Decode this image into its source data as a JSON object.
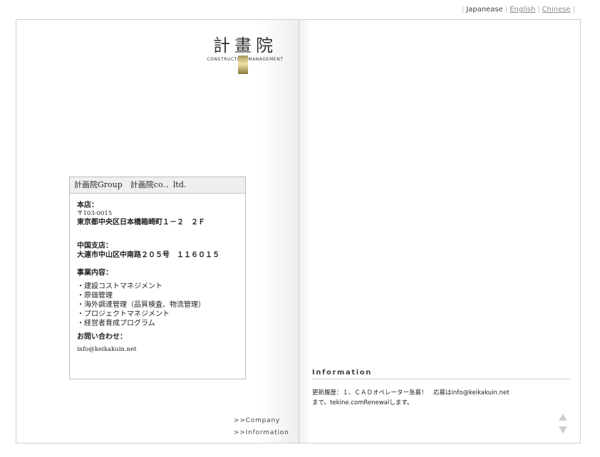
{
  "language_bar": {
    "current": "Japanease",
    "english": "English",
    "chinese": "Chinese"
  },
  "logo": {
    "title": "計畫院",
    "subtitle": "Construction Management"
  },
  "company_box": {
    "header": "計画院Group　計画院co.．ltd.",
    "head_office_label": "本店：",
    "head_office_zip": "〒103-0015",
    "head_office_address": "東京都中央区日本橋箱崎町１－２　２Ｆ",
    "china_branch_label": "中国支店：",
    "china_branch_address": "大連市中山区中南路２０５号　１１６０１５",
    "business_label": "事業内容：",
    "business_items": [
      "・建設コストマネジメント",
      "・原価管理",
      "・海外調達管理（品質検査、物流管理）",
      "・プロジェクトマネジメント",
      "・経営者育成プログラム"
    ],
    "contact_label": "お問い合わせ：",
    "contact_email": "info@keikakuin.net"
  },
  "nav": {
    "company": ">>Company",
    "information": ">>Information"
  },
  "information": {
    "title": "Information",
    "line1": "更新履歴：１、ＣＡＤオペレーター急募！　応募はinfo@keikakuin.net",
    "line2": "まで。tekine.comRenewalします。"
  },
  "colors": {
    "border": "#cfcfcf",
    "header_bg": "#efefef",
    "seal_gold": "#efe3a8"
  }
}
